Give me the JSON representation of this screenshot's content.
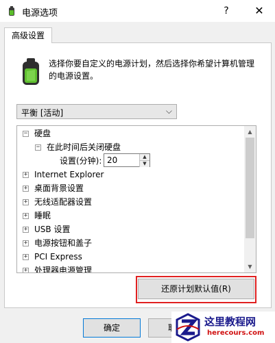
{
  "window": {
    "title": "电源选项",
    "help_label": "?",
    "close_label": "✕"
  },
  "tab": {
    "label": "高级设置"
  },
  "intro": {
    "text": "选择你要自定义的电源计划，然后选择你希望计算机管理的电源设置。"
  },
  "plan_select": {
    "value": "平衡 [活动]"
  },
  "tree": {
    "items": [
      {
        "expander": "⊟",
        "label": "硬盘"
      },
      {
        "expander": "⊟",
        "label": "在此时间后关闭硬盘"
      },
      {
        "expander": "",
        "label": "设置(分钟):"
      },
      {
        "expander": "⊞",
        "label": "Internet Explorer"
      },
      {
        "expander": "⊞",
        "label": "桌面背景设置"
      },
      {
        "expander": "⊞",
        "label": "无线适配器设置"
      },
      {
        "expander": "⊞",
        "label": "睡眠"
      },
      {
        "expander": "⊞",
        "label": "USB 设置"
      },
      {
        "expander": "⊞",
        "label": "电源按钮和盖子"
      },
      {
        "expander": "⊞",
        "label": "PCI Express"
      },
      {
        "expander": "⊞",
        "label": "处理器电源管理"
      }
    ],
    "minutes_value": "20"
  },
  "buttons": {
    "restore": "还原计划默认值(R)",
    "ok": "确定",
    "cancel": "取"
  },
  "watermark": {
    "cn": "这里教程网",
    "en": "herecours.com"
  },
  "colors": {
    "highlight": "#e02020",
    "focus_border": "#0078d7",
    "watermark_blue": "#1a1a8c",
    "watermark_red": "#d01010"
  }
}
